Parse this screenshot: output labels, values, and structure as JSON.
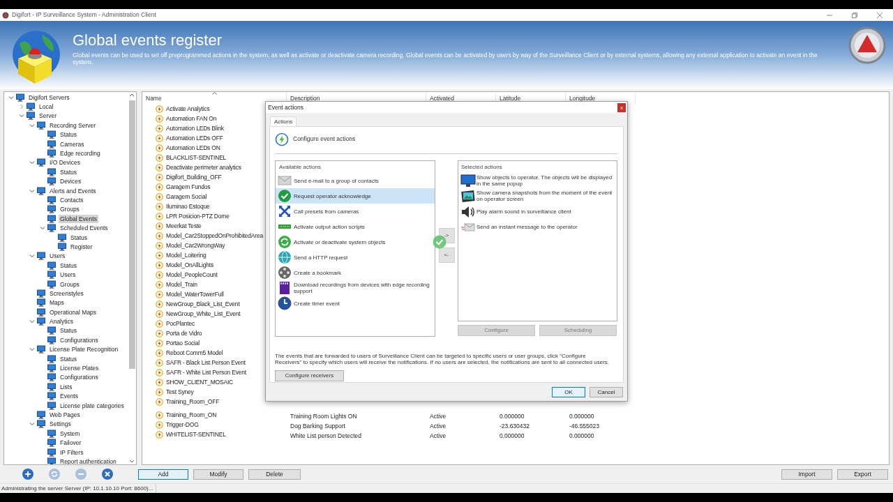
{
  "window": {
    "title": "Digifort - IP Surveillance System - Administration Client"
  },
  "header": {
    "title": "Global events register",
    "description": "Global events can be used to set off preprogrammed actions in the system, as well as activate or deactivate camera recording. Global events can be activated by users by way of the Surveillance Client or by external systems, allowing any external application to activate an event in the system."
  },
  "tree": {
    "items": [
      {
        "label": "Digifort Servers",
        "selected": false,
        "expanded": true,
        "children": [
          {
            "label": "Local",
            "selected": false,
            "expanded": false
          },
          {
            "label": "Server",
            "selected": false,
            "expanded": true,
            "children": [
              {
                "label": "Recording Server",
                "selected": false,
                "expanded": true,
                "children": [
                  {
                    "label": "Status",
                    "selected": false
                  },
                  {
                    "label": "Cameras",
                    "selected": false
                  },
                  {
                    "label": "Edge recording",
                    "selected": false
                  }
                ]
              },
              {
                "label": "I/O Devices",
                "selected": false,
                "expanded": true,
                "children": [
                  {
                    "label": "Status",
                    "selected": false
                  },
                  {
                    "label": "Devices",
                    "selected": false
                  }
                ]
              },
              {
                "label": "Alerts and Events",
                "selected": false,
                "expanded": true,
                "children": [
                  {
                    "label": "Contacts",
                    "selected": false
                  },
                  {
                    "label": "Groups",
                    "selected": false
                  },
                  {
                    "label": "Global Events",
                    "selected": true
                  },
                  {
                    "label": "Scheduled Events",
                    "selected": false,
                    "expanded": true,
                    "children": [
                      {
                        "label": "Status",
                        "selected": false
                      },
                      {
                        "label": "Register",
                        "selected": false
                      }
                    ]
                  }
                ]
              },
              {
                "label": "Users",
                "selected": false,
                "expanded": true,
                "children": [
                  {
                    "label": "Status",
                    "selected": false
                  },
                  {
                    "label": "Users",
                    "selected": false
                  },
                  {
                    "label": "Groups",
                    "selected": false
                  }
                ]
              },
              {
                "label": "Screenstyles",
                "selected": false
              },
              {
                "label": "Maps",
                "selected": false
              },
              {
                "label": "Operational Maps",
                "selected": false
              },
              {
                "label": "Analytics",
                "selected": false,
                "expanded": true,
                "children": [
                  {
                    "label": "Status",
                    "selected": false
                  },
                  {
                    "label": "Configurations",
                    "selected": false
                  }
                ]
              },
              {
                "label": "License Plate Recognition",
                "selected": false,
                "expanded": true,
                "children": [
                  {
                    "label": "Status",
                    "selected": false
                  },
                  {
                    "label": "License Plates",
                    "selected": false
                  },
                  {
                    "label": "Configurations",
                    "selected": false
                  },
                  {
                    "label": "Lists",
                    "selected": false
                  },
                  {
                    "label": "Events",
                    "selected": false
                  },
                  {
                    "label": "License plate categories",
                    "selected": false
                  }
                ]
              },
              {
                "label": "Web Pages",
                "selected": false
              },
              {
                "label": "Settings",
                "selected": false,
                "expanded": true,
                "children": [
                  {
                    "label": "System",
                    "selected": false
                  },
                  {
                    "label": "Failover",
                    "selected": false
                  },
                  {
                    "label": "IP Filters",
                    "selected": false
                  },
                  {
                    "label": "Report authentication",
                    "selected": false
                  }
                ]
              }
            ]
          }
        ]
      }
    ]
  },
  "event_table": {
    "columns": [
      {
        "label": "Name",
        "sorted": true
      },
      {
        "label": "Description",
        "sorted": false
      },
      {
        "label": "Activated",
        "sorted": false
      },
      {
        "label": "Latitude",
        "sorted": false
      },
      {
        "label": "Longitude",
        "sorted": false
      }
    ],
    "rows": [
      {
        "name": "Activate Analytics"
      },
      {
        "name": "Automation FAN On"
      },
      {
        "name": "Automation LEDs Blink"
      },
      {
        "name": "Automation LEDs OFF"
      },
      {
        "name": "Automation LEDs ON"
      },
      {
        "name": "BLACKLIST-SENTINEL"
      },
      {
        "name": "Deactivate perimeter analytics"
      },
      {
        "name": "Digifort_Building_OFF"
      },
      {
        "name": "Garagem Fundos"
      },
      {
        "name": "Garagem Social"
      },
      {
        "name": "Iluminao Estoque"
      },
      {
        "name": "LPR Posicion-PTZ Dome"
      },
      {
        "name": "Meerkat Teste"
      },
      {
        "name": "Model_Car2StoppedOnProhibitedArea"
      },
      {
        "name": "Model_Car2WrongWay"
      },
      {
        "name": "Model_Loitering"
      },
      {
        "name": "Model_OnAllLights"
      },
      {
        "name": "Model_PeopleCount"
      },
      {
        "name": "Model_Train"
      },
      {
        "name": "Model_WaterTowerFull"
      },
      {
        "name": "NewGroup_Black_List_Event"
      },
      {
        "name": "NewGroup_White_List_Event"
      },
      {
        "name": "PocPlantec"
      },
      {
        "name": "Porta de Vidro"
      },
      {
        "name": "Portao Social"
      },
      {
        "name": "Reboot Comm5 Model"
      },
      {
        "name": "SAFR - Black List Person Event"
      },
      {
        "name": "SAFR - White List Person Event"
      },
      {
        "name": "SHOW_CLIENT_MOSAIC"
      },
      {
        "name": "Test Syney"
      },
      {
        "name": "Training_Room_OFF"
      },
      {
        "name": "Training_Room_ON",
        "description": "Training Room Lights ON",
        "activated": "Active",
        "latitude": "0.000000",
        "longitude": "0.000000"
      },
      {
        "name": "Trigger-DOG",
        "description": "Dog Barking Support",
        "activated": "Active",
        "latitude": "-23.630432",
        "longitude": "-46.555023"
      },
      {
        "name": "WHITELIST-SENTINEL",
        "description": "White List person Detected",
        "activated": "Active",
        "latitude": "0.000000",
        "longitude": "0.000000"
      }
    ]
  },
  "toolbar": [
    {
      "kind": "add",
      "disabled": false
    },
    {
      "kind": "refresh",
      "disabled": true
    },
    {
      "kind": "remove",
      "disabled": true
    },
    {
      "kind": "delete",
      "disabled": false
    }
  ],
  "buttons": [
    {
      "label": "Add",
      "focused": true
    },
    {
      "label": "Modify",
      "focused": false
    },
    {
      "label": "Delete",
      "focused": false
    }
  ],
  "transfer_buttons": [
    {
      "label": "Import"
    },
    {
      "label": "Export"
    }
  ],
  "status_bar": "Administrating the server Server (IP: 10.1.10.10 Port: 8600)...",
  "dialog": {
    "title": "Event actions",
    "close_label": "x",
    "tabs": [
      {
        "label": "Actions",
        "selected": true
      }
    ],
    "heading": "Configure event actions",
    "available_actions": {
      "title": "Available actions",
      "items": [
        {
          "label": "Send e-mail to a group of contacts",
          "selected": false
        },
        {
          "label": "Request operator acknowledge",
          "selected": true
        },
        {
          "label": "Call presets from cameras",
          "selected": false
        },
        {
          "label": "Activate output action scripts",
          "selected": false
        },
        {
          "label": "Activate or deactivate system objects",
          "selected": false
        },
        {
          "label": "Send a HTTP request",
          "selected": false
        },
        {
          "label": "Create a bookmark",
          "selected": false
        },
        {
          "label": "Download recordings from devices with edge recording support",
          "selected": false
        },
        {
          "label": "Create timer event",
          "selected": false
        }
      ]
    },
    "move_buttons": [
      "->",
      "<-"
    ],
    "selected_actions": {
      "title": "Selected actions",
      "items": [
        {
          "label": "Show objects to operator. The objects will be displayed in the same popup"
        },
        {
          "label": "Show camera snapshots from the moment of the event on operator screen"
        },
        {
          "label": "Play alarm sound in surveillance client"
        },
        {
          "label": "Send an instant message to the operator"
        }
      ]
    },
    "action_buttons": [
      {
        "label": "Configure",
        "disabled": true
      },
      {
        "label": "Scheduling",
        "disabled": true
      }
    ],
    "note": "The events that are forwarded to users of Surveillance Client can be targeted to specific users or user groups, click \"Configure Receivers\" to specify which users will receive the notifications. If no users are selected, the notifications are sent to all connected users.",
    "receivers_button": "Configure receivers",
    "buttons": [
      {
        "label": "OK",
        "focused": true
      },
      {
        "label": "Cancel",
        "focused": false
      }
    ]
  }
}
